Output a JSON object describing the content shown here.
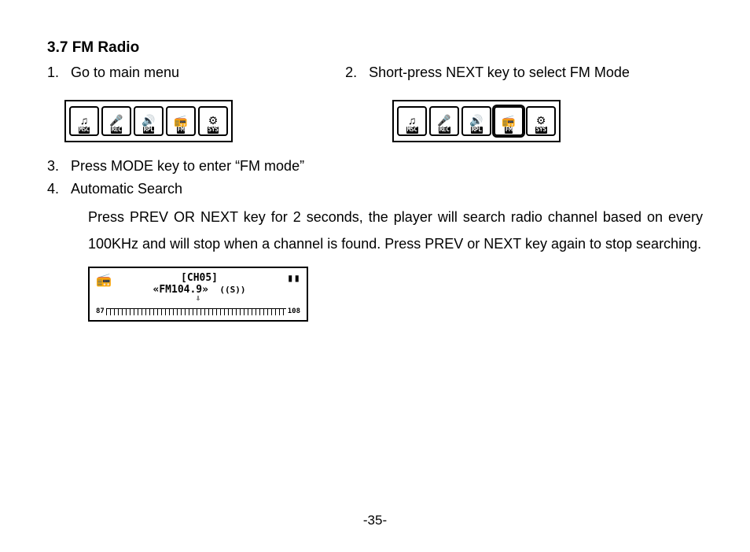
{
  "title": "3.7 FM Radio",
  "item1_num": "1.",
  "item1_text": "Go to main menu",
  "item2_num": "2.",
  "item2_text": "Short-press NEXT key to select FM Mode",
  "item3_num": "3.",
  "item3_text": "Press MODE key to enter “FM mode”",
  "item4_num": "4.",
  "item4_text": "Automatic Search",
  "item4_body": "Press PREV OR NEXT key for 2 seconds, the player will search radio channel based on every 100KHz and will stop when a channel is found. Press PREV or NEXT key again to stop searching.",
  "menu_icons": {
    "msc": "MSC",
    "rec": "REC",
    "rpl": "RPL",
    "fm": "FM",
    "sys": "SYS"
  },
  "fm_display": {
    "channel": "[CH05]",
    "freq": "«FM104.9»",
    "stereo": "S",
    "scale_start": "87",
    "scale_end": "108"
  },
  "page_number": "-35-"
}
